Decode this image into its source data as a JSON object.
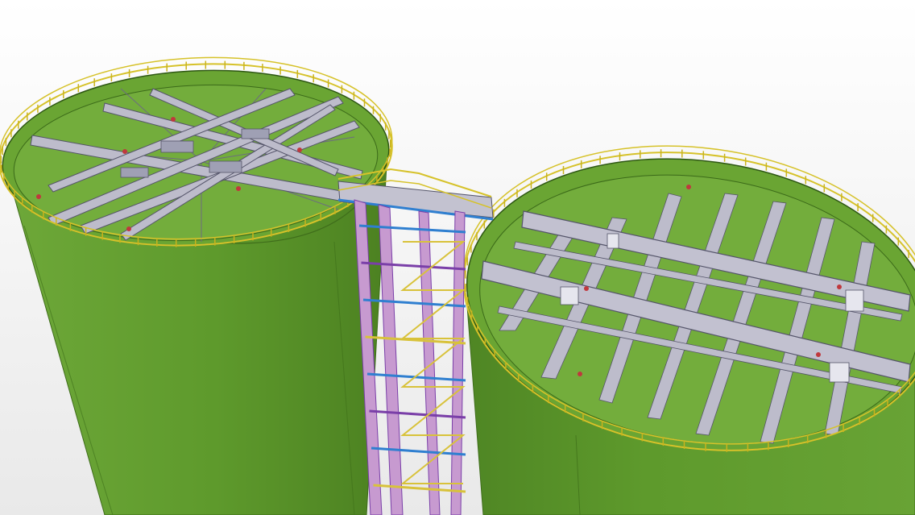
{
  "scene": {
    "description_label": "",
    "colors": {
      "background_top": "#ffffff",
      "background_bottom": "#e9e9e9",
      "tank_shell": "#5e9a2c",
      "tank_shell_dark": "#4c8121",
      "tank_shell_light": "#6ea839",
      "roof_fill": "#6aa533",
      "steel_beam": "#bdbccb",
      "steel_beam_edge": "#55556a",
      "handrail": "#d6c22a",
      "handrail_post": "#c9b31d",
      "tower_column": "#c79ad0",
      "tower_brace_blue": "#2f7fd0",
      "tower_brace_purple": "#7a3fa8",
      "stair": "#d8c23a",
      "bolt_marker": "#c0383d"
    },
    "objects": [
      {
        "name": "left-storage-tank",
        "kind": "cylindrical tank with open roof framing"
      },
      {
        "name": "right-storage-tank",
        "kind": "cylindrical tank with open roof framing"
      },
      {
        "name": "stair-tower",
        "kind": "steel stair tower with bridge platform"
      }
    ]
  }
}
